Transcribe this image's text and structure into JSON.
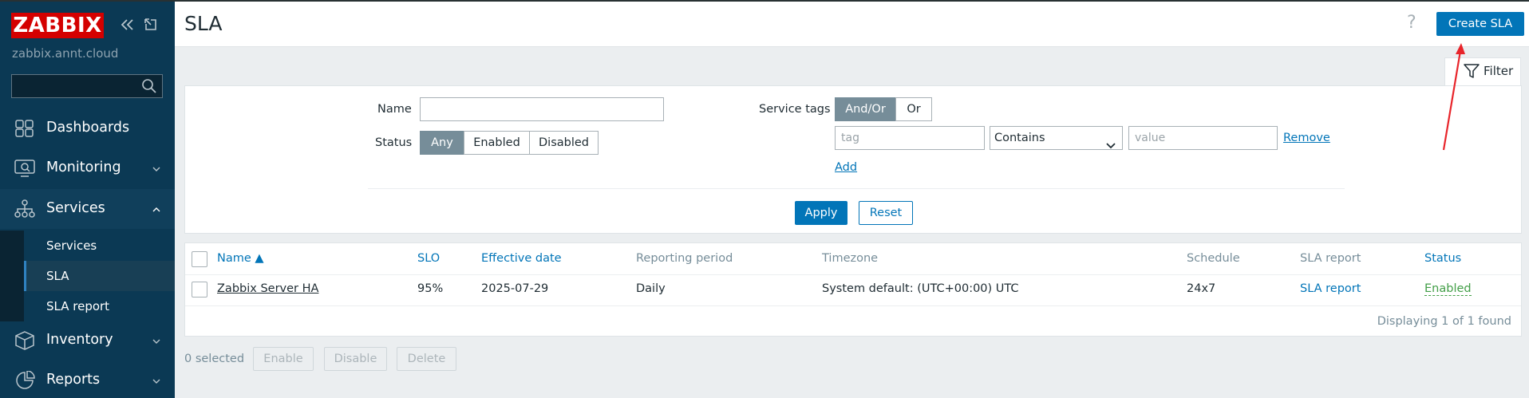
{
  "sidebar": {
    "logo": "ZABBIX",
    "server_name": "zabbix.annt.cloud",
    "search_placeholder": "",
    "nav": [
      {
        "label": "Dashboards",
        "icon": "dashboards-icon"
      },
      {
        "label": "Monitoring",
        "icon": "monitoring-icon"
      },
      {
        "label": "Services",
        "icon": "services-icon"
      },
      {
        "label": "Inventory",
        "icon": "inventory-icon"
      },
      {
        "label": "Reports",
        "icon": "reports-icon"
      }
    ],
    "services_sub": [
      "Services",
      "SLA",
      "SLA report"
    ]
  },
  "header": {
    "title": "SLA",
    "help": "?",
    "create_button": "Create SLA"
  },
  "filter": {
    "tab_label": "Filter",
    "name_label": "Name",
    "name_value": "",
    "status_label": "Status",
    "status_options": [
      "Any",
      "Enabled",
      "Disabled"
    ],
    "status_selected": "Any",
    "service_tags_label": "Service tags",
    "tag_mode_options": [
      "And/Or",
      "Or"
    ],
    "tag_mode_selected": "And/Or",
    "tag_placeholder": "tag",
    "operator_value": "Contains",
    "value_placeholder": "value",
    "remove_label": "Remove",
    "add_label": "Add",
    "apply_label": "Apply",
    "reset_label": "Reset"
  },
  "table": {
    "columns": [
      "Name ▲",
      "SLO",
      "Effective date",
      "Reporting period",
      "Timezone",
      "Schedule",
      "SLA report",
      "Status"
    ],
    "rows": [
      {
        "name": "Zabbix Server HA",
        "slo": "95%",
        "effective_date": "2025-07-29",
        "reporting_period": "Daily",
        "timezone": "System default: (UTC+00:00) UTC",
        "schedule": "24x7",
        "sla_report": "SLA report",
        "status": "Enabled"
      }
    ],
    "footer": "Displaying 1 of 1 found"
  },
  "actions": {
    "selected_text": "0 selected",
    "enable_label": "Enable",
    "disable_label": "Disable",
    "delete_label": "Delete"
  },
  "colors": {
    "sidebar_bg": "#0b3954",
    "accent": "#0275b8",
    "logo_red": "#d40000",
    "enabled_green": "#429e47",
    "annotation_arrow": "#e8242a"
  }
}
